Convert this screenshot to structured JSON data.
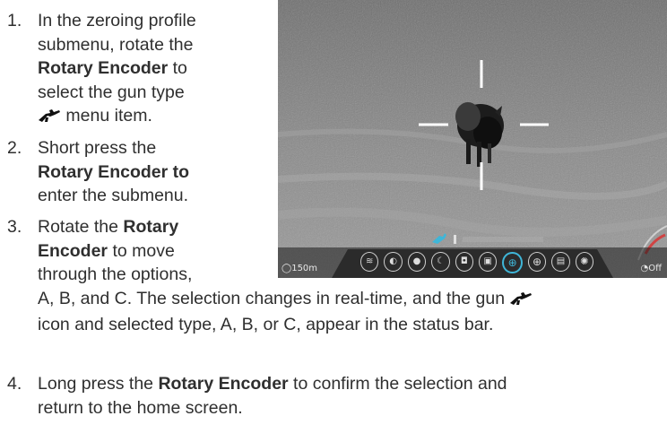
{
  "steps": [
    {
      "num": "1.",
      "lines": [
        "In the zeroing profile",
        "submenu, rotate the",
        "Rotary Encoder to",
        "select the gun type",
        "menu item."
      ],
      "bold_term": "Rotary Encoder"
    },
    {
      "num": "2.",
      "lines": [
        "Short press the",
        "Rotary Encoder to",
        "enter the submenu."
      ]
    },
    {
      "num": "3.",
      "l1_pre": "Rotate the ",
      "l1_bold": "Rotary",
      "l2_bold": "Encoder",
      "l2_post": " to move",
      "l3": "through the options,",
      "l4_pre": "A, B, and C. The selection changes in real-time, and the gun",
      "l5": "icon and selected type, A, B, or C, appear in the status bar."
    },
    {
      "num": "4.",
      "l1_pre": "Long press the ",
      "l1_bold": "Rotary Encoder",
      "l1_post": " to confirm the selection and",
      "l2": "return to the home screen."
    }
  ],
  "screen": {
    "left_readout": "150m",
    "right_readout": "Off",
    "status_text": "A",
    "menu_icons": [
      "wifi-icon",
      "compass-icon",
      "microphone-icon",
      "phone-icon",
      "camera-icon",
      "image-icon",
      "crosshair-selected-icon",
      "crosshair-icon",
      "calendar-icon",
      "settings-icon"
    ],
    "accent_color": "#3fb6d8"
  }
}
